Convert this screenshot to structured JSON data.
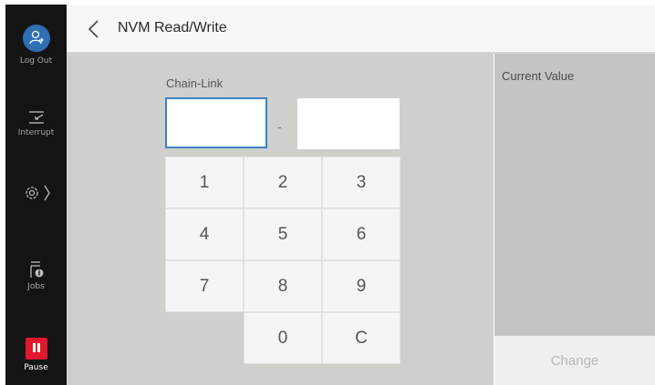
{
  "sidebar": {
    "logout_label": "Log Out",
    "interrupt_label": "Interrupt",
    "jobs_label": "Jobs",
    "pause_label": "Pause"
  },
  "header": {
    "title": "NVM Read/Write"
  },
  "form": {
    "chain_link_label": "Chain-Link",
    "separator": "-",
    "chain_value": "",
    "link_value": ""
  },
  "keypad": {
    "keys": [
      "1",
      "2",
      "3",
      "4",
      "5",
      "6",
      "7",
      "8",
      "9",
      "0",
      "C"
    ]
  },
  "right_panel": {
    "title": "Current Value",
    "change_label": "Change"
  },
  "colors": {
    "accent": "#2f6fb3",
    "pause": "#e0182d",
    "focus_border": "#3b82c4"
  }
}
